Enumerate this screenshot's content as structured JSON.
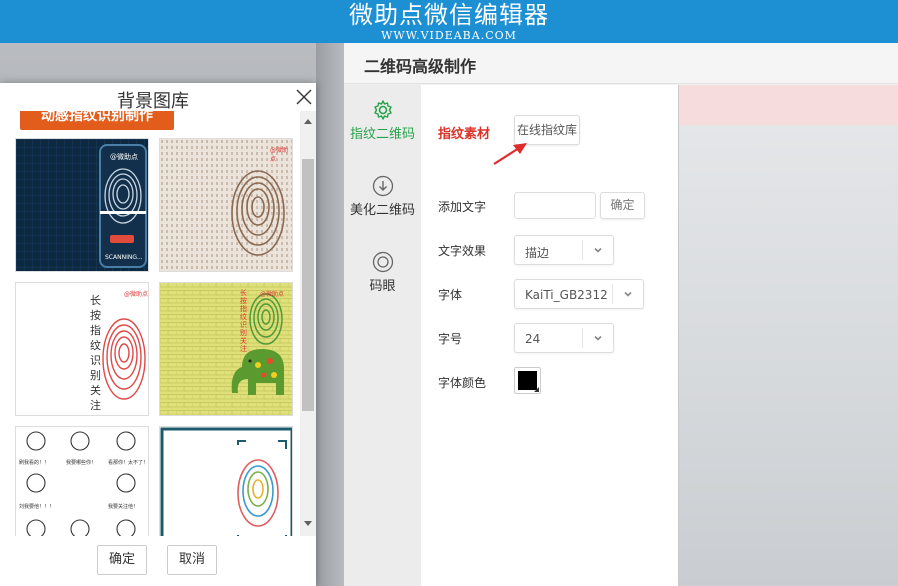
{
  "banner": {
    "title": "微助点微信编辑器",
    "url": "WWW.VIDEABA.COM"
  },
  "editor": {
    "title": "二维码高级制作",
    "nav": [
      {
        "label": "指纹二维码",
        "icon": "gear-icon",
        "active": true
      },
      {
        "label": "美化二维码",
        "icon": "download-circle-icon",
        "active": false
      },
      {
        "label": "码眼",
        "icon": "target-icon",
        "active": false
      }
    ],
    "form": {
      "material_label": "指纹素材",
      "online_library_button": "在线指纹库",
      "add_text_label": "添加文字",
      "add_text_value": "",
      "confirm_button": "确定",
      "text_effect_label": "文字效果",
      "text_effect_value": "描边",
      "font_label": "字体",
      "font_value": "KaiTi_GB2312",
      "font_size_label": "字号",
      "font_size_value": "24",
      "font_color_label": "字体颜色",
      "font_color": "#000000"
    }
  },
  "dialog": {
    "title": "背景图库",
    "top_button": "动感指纹识别制作",
    "thumbnails": [
      {
        "text": "@微助点",
        "subtext": "SCANNING..."
      },
      {
        "text": "@微助点"
      },
      {
        "text": "@微助点",
        "vertical": "长按指纹识别关注"
      },
      {
        "text": "@微助点",
        "vertical": "长按指纹识别关注"
      },
      {
        "captions": [
          "刷我看的！！",
          "我要哪些你！",
          "看那你！太不了！",
          "刘我要他！！！",
          "我要关注他！"
        ]
      },
      {
        "text": ""
      }
    ],
    "ok_button": "确定",
    "cancel_button": "取消"
  },
  "colors": {
    "brand_blue": "#1d8fd3",
    "accent_green": "#27a14a",
    "accent_red": "#d9332b",
    "orange": "#e25d1c"
  }
}
